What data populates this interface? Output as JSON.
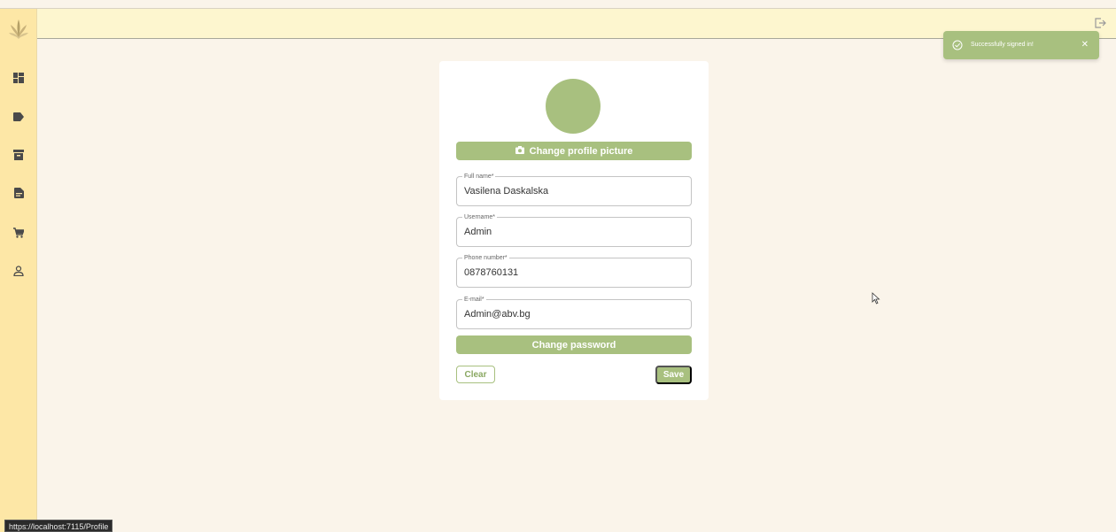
{
  "sidebar": {
    "logo_icon": "plant-logo",
    "items": [
      {
        "icon": "dashboard-icon"
      },
      {
        "icon": "tag-icon"
      },
      {
        "icon": "archive-icon"
      },
      {
        "icon": "document-icon"
      },
      {
        "icon": "cart-icon"
      },
      {
        "icon": "user-icon"
      }
    ]
  },
  "header": {
    "logout_icon": "logout-icon"
  },
  "profile": {
    "change_picture_label": "Change profile picture",
    "fields": [
      {
        "label": "Full name*",
        "value": "Vasilena Daskalska"
      },
      {
        "label": "Username*",
        "value": "Admin"
      },
      {
        "label": "Phone number*",
        "value": "0878760131"
      },
      {
        "label": "E-mail*",
        "value": "Admin@abv.bg"
      }
    ],
    "change_password_label": "Change password",
    "clear_label": "Clear",
    "save_label": "Save"
  },
  "toast": {
    "message": "Successfully signed in!",
    "close": "✕"
  },
  "statusbar": {
    "url": "https://localhost:7115/Profile"
  },
  "colors": {
    "accent": "#a8c07f",
    "sidebar": "#fde7a6",
    "header": "#fdf6cf",
    "background": "#faf4ea"
  }
}
